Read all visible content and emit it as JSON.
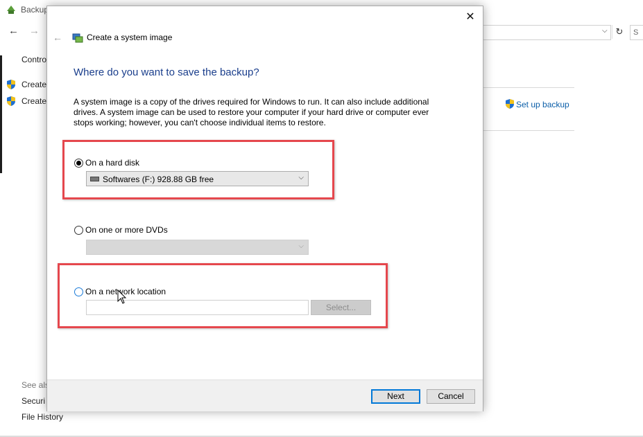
{
  "background": {
    "title": "Backup",
    "search_stub": "S",
    "left_links": [
      "Contro",
      "Create",
      "Create"
    ],
    "setup_backup": "Set up backup",
    "see_also": "See als",
    "bottom_links": [
      "Securi",
      "File History"
    ]
  },
  "dialog": {
    "title": "Create a system image",
    "heading": "Where do you want to save the backup?",
    "description": "A system image is a copy of the drives required for Windows to run. It can also include additional drives. A system image can be used to restore your computer if your hard drive or computer ever stops working; however, you can't choose individual items to restore.",
    "options": {
      "hard_disk": {
        "label": "On a hard disk",
        "selected": true,
        "drive_value": "Softwares (F:)  928.88 GB free"
      },
      "dvds": {
        "label": "On one or more DVDs",
        "selected": false,
        "drive_value": ""
      },
      "network": {
        "label": "On a network location",
        "selected": false,
        "path_value": "",
        "select_button": "Select..."
      }
    },
    "buttons": {
      "next": "Next",
      "cancel": "Cancel"
    }
  },
  "colors": {
    "heading": "#1a3e8c",
    "link": "#0b5ea8",
    "annotation": "#e5474d",
    "default_button_border": "#0078d7"
  },
  "icons": {
    "close": "close-icon",
    "back": "back-arrow-icon",
    "dialog_title": "system-image-icon",
    "shield": "uac-shield-icon",
    "drive": "hard-drive-icon",
    "chevron": "chevron-down-icon",
    "cursor": "mouse-pointer-icon"
  }
}
